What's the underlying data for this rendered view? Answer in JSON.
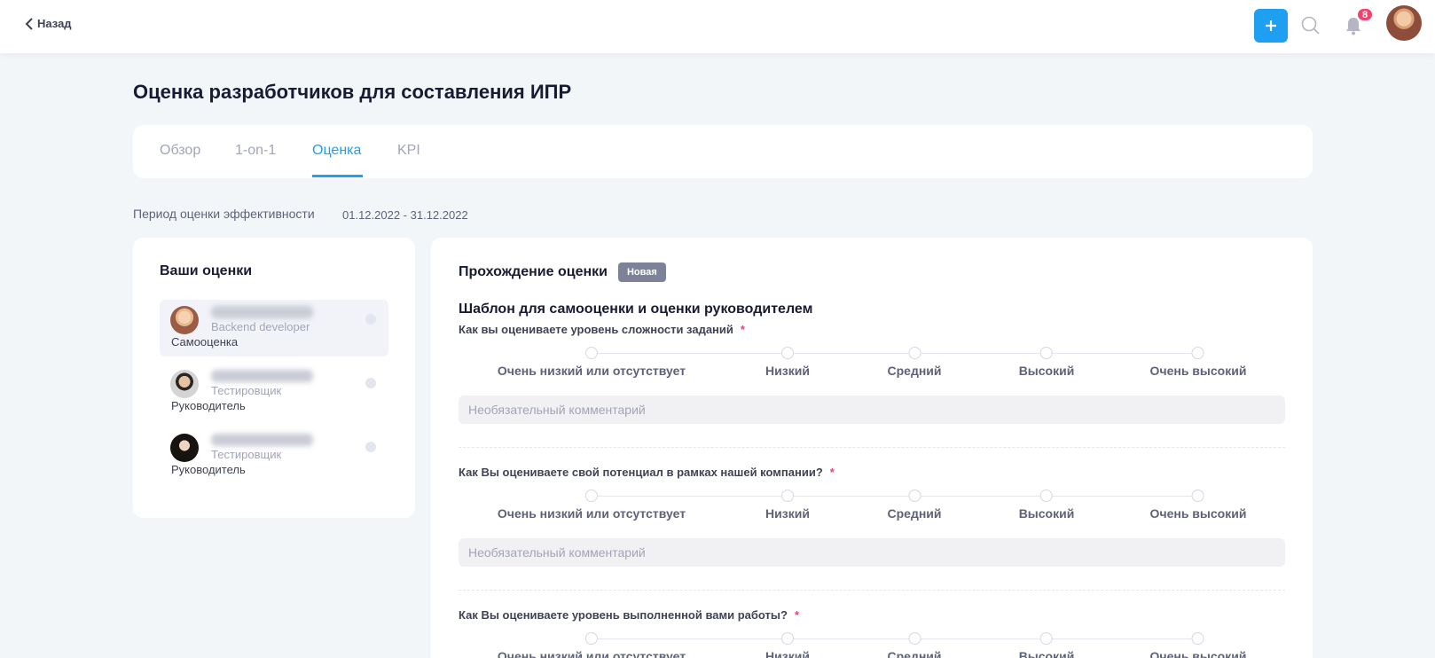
{
  "header": {
    "back_label": "Назад",
    "notifications_count": "8"
  },
  "page": {
    "title": "Оценка разработчиков для составления ИПР",
    "tabs": [
      {
        "label": "Обзор"
      },
      {
        "label": "1-on-1"
      },
      {
        "label": "Оценка"
      },
      {
        "label": "KPI"
      }
    ],
    "active_tab": "Оценка",
    "period_label": "Период оценки эффективности",
    "period_dates": "01.12.2022 - 31.12.2022"
  },
  "sidebar": {
    "title": "Ваши оценки",
    "items": [
      {
        "role": "Backend developer",
        "type": "Самооценка"
      },
      {
        "role": "Тестировщик",
        "type": "Руководитель"
      },
      {
        "role": "Тестировщик",
        "type": "Руководитель"
      }
    ]
  },
  "evaluation": {
    "title": "Прохождение оценки",
    "status": "Новая",
    "template_title": "Шаблон для самооценки и оценки руководителем",
    "scale_options": [
      "Очень низкий или отсутствует",
      "Низкий",
      "Средний",
      "Высокий",
      "Очень высокий"
    ],
    "comment_placeholder": "Необязательный комментарий",
    "required_mark": "*",
    "questions": [
      {
        "text": "Как вы оцениваете уровень сложности заданий"
      },
      {
        "text": "Как Вы оцениваете свой потенциал в рамках нашей компании?"
      },
      {
        "text": "Как Вы оцениваете уровень выполненной вами работы?"
      }
    ]
  },
  "colors": {
    "accent": "#1e9ff2",
    "badge": "#f1416c",
    "status_badge": "#7e8299"
  }
}
